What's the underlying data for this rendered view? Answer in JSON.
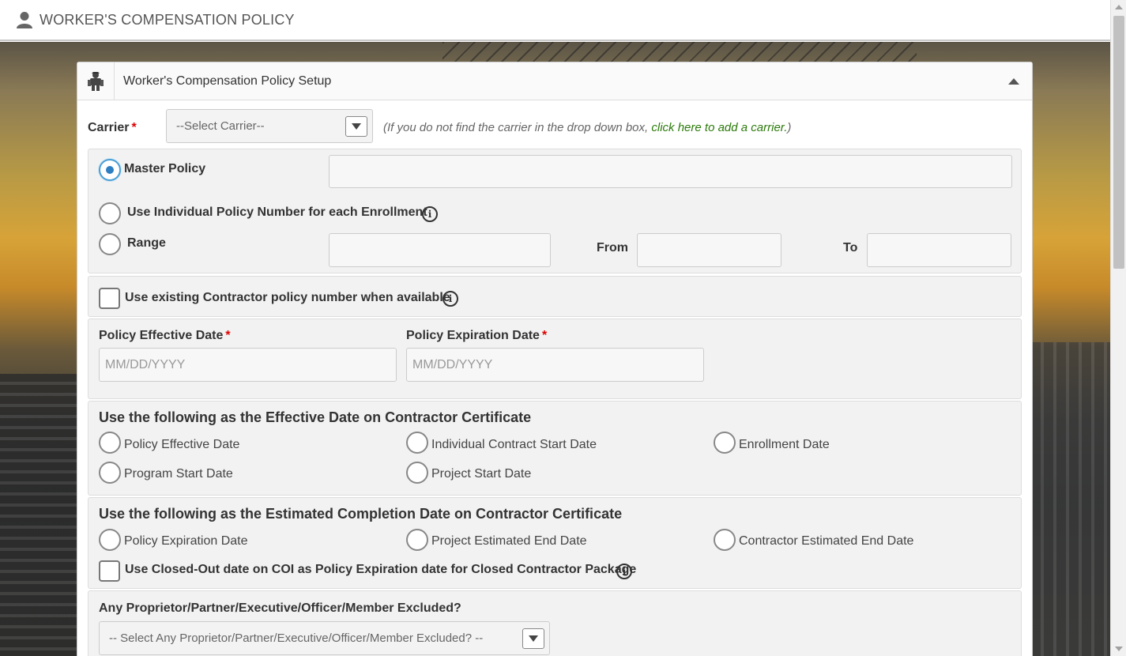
{
  "header": {
    "title": "WORKER'S COMPENSATION POLICY"
  },
  "panel": {
    "title": "Worker's Compensation Policy Setup"
  },
  "carrier": {
    "label": "Carrier",
    "required_mark": "*",
    "selected": "--Select Carrier--",
    "note_prefix": "(If you do not find the carrier in the drop down box, ",
    "note_link": "click here to add a carrier.",
    "note_suffix": ")"
  },
  "policy_type": {
    "master_label": "Master Policy",
    "master_value": "",
    "individual_label": "Use Individual Policy Number for each Enrollment",
    "range_label": "Range",
    "from_label": "From",
    "to_label": "To"
  },
  "existing": {
    "label": "Use existing Contractor policy number when available"
  },
  "dates": {
    "effective_label": "Policy Effective Date",
    "expiration_label": "Policy Expiration Date",
    "required_mark": "*",
    "effective_placeholder": "MM/DD/YYYY",
    "expiration_placeholder": "MM/DD/YYYY"
  },
  "effective_cert": {
    "title": "Use the following as the Effective Date on Contractor Certificate",
    "options": [
      "Policy Effective Date",
      "Individual Contract Start Date",
      "Enrollment Date",
      "Program Start Date",
      "Project Start Date"
    ]
  },
  "completion_cert": {
    "title": "Use the following as the Estimated Completion Date on Contractor Certificate",
    "options": [
      "Policy Expiration Date",
      "Project Estimated End Date",
      "Contractor Estimated End Date"
    ],
    "closed_out_label": "Use Closed-Out date on COI as Policy Expiration date for Closed Contractor Package"
  },
  "excluded": {
    "label": "Any Proprietor/Partner/Executive/Officer/Member Excluded?",
    "selected": "-- Select Any Proprietor/Partner/Executive/Officer/Member Excluded? --"
  },
  "colors": {
    "accent": "#2d7fc1",
    "link": "#2b7a0b",
    "required": "#dd0000"
  }
}
